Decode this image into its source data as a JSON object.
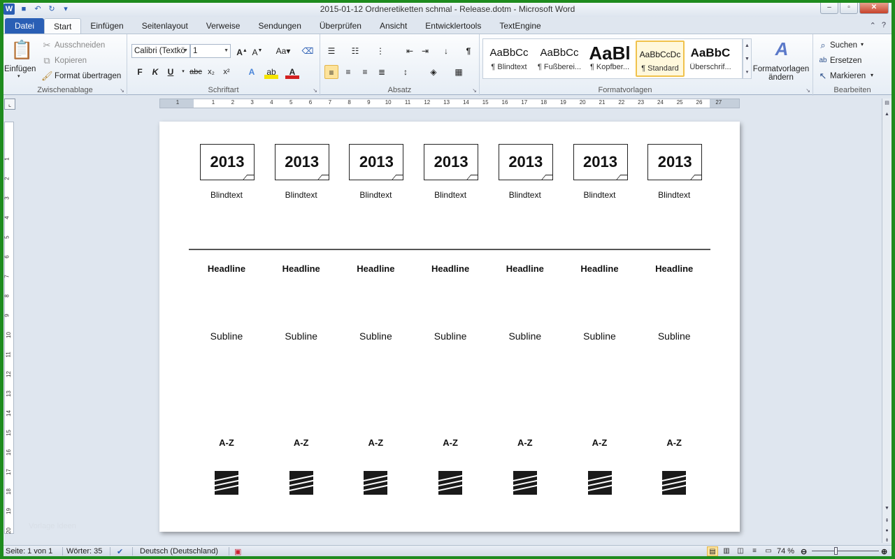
{
  "window": {
    "title": "2015-01-12 Ordneretiketten schmal - Release.dotm  -  Microsoft Word"
  },
  "tabs": [
    {
      "label": "Datei"
    },
    {
      "label": "Start"
    },
    {
      "label": "Einfügen"
    },
    {
      "label": "Seitenlayout"
    },
    {
      "label": "Verweise"
    },
    {
      "label": "Sendungen"
    },
    {
      "label": "Überprüfen"
    },
    {
      "label": "Ansicht"
    },
    {
      "label": "Entwicklertools"
    },
    {
      "label": "TextEngine"
    }
  ],
  "ribbon": {
    "clipboard": {
      "label": "Zwischenablage",
      "paste": "Einfügen",
      "cut": "Ausschneiden",
      "copy": "Kopieren",
      "format_painter": "Format übertragen"
    },
    "font": {
      "label": "Schriftart",
      "font_name": "Calibri (Textkö",
      "font_size": "1",
      "bold": "F",
      "italic": "K",
      "underline": "U",
      "strikethrough": "abc",
      "subscript": "x₂",
      "superscript": "x²"
    },
    "paragraph": {
      "label": "Absatz"
    },
    "styles": {
      "label": "Formatvorlagen",
      "items": [
        {
          "preview": "AaBbCc",
          "name": "¶ Blindtext"
        },
        {
          "preview": "AaBbCc",
          "name": "¶ Fußberei..."
        },
        {
          "preview": "AaBl",
          "name": "¶ Kopfber..."
        },
        {
          "preview": "AaBbCcDc",
          "name": "¶ Standard"
        },
        {
          "preview": "AaBbC",
          "name": "Überschrif..."
        }
      ],
      "change_styles_line1": "Formatvorlagen",
      "change_styles_line2": "ändern"
    },
    "editing": {
      "label": "Bearbeiten",
      "find": "Suchen",
      "replace": "Ersetzen",
      "select": "Markieren"
    }
  },
  "ruler": {
    "h_numbers": [
      "1",
      "1",
      "2",
      "3",
      "4",
      "5",
      "6",
      "7",
      "8",
      "9",
      "10",
      "11",
      "12",
      "13",
      "14",
      "15",
      "16",
      "17",
      "18",
      "19",
      "20",
      "21",
      "22",
      "23",
      "24",
      "25",
      "26",
      "27"
    ],
    "v_numbers": [
      "1",
      "2",
      "3",
      "4",
      "5",
      "6",
      "7",
      "8",
      "9",
      "10",
      "11",
      "12",
      "13",
      "14",
      "15",
      "16",
      "17",
      "18",
      "19",
      "20"
    ]
  },
  "document": {
    "labels": [
      {
        "year": "2013",
        "blindtext": "Blindtext",
        "headline": "Headline",
        "subline": "Subline",
        "az": "A-Z"
      },
      {
        "year": "2013",
        "blindtext": "Blindtext",
        "headline": "Headline",
        "subline": "Subline",
        "az": "A-Z"
      },
      {
        "year": "2013",
        "blindtext": "Blindtext",
        "headline": "Headline",
        "subline": "Subline",
        "az": "A-Z"
      },
      {
        "year": "2013",
        "blindtext": "Blindtext",
        "headline": "Headline",
        "subline": "Subline",
        "az": "A-Z"
      },
      {
        "year": "2013",
        "blindtext": "Blindtext",
        "headline": "Headline",
        "subline": "Subline",
        "az": "A-Z"
      },
      {
        "year": "2013",
        "blindtext": "Blindtext",
        "headline": "Headline",
        "subline": "Subline",
        "az": "A-Z"
      },
      {
        "year": "2013",
        "blindtext": "Blindtext",
        "headline": "Headline",
        "subline": "Subline",
        "az": "A-Z"
      }
    ]
  },
  "watermark": "Vorlage Ideen",
  "status": {
    "page": "Seite: 1 von 1",
    "words": "Wörter: 35",
    "language": "Deutsch (Deutschland)",
    "zoom": "74 %",
    "zoom_level": 0.74
  }
}
